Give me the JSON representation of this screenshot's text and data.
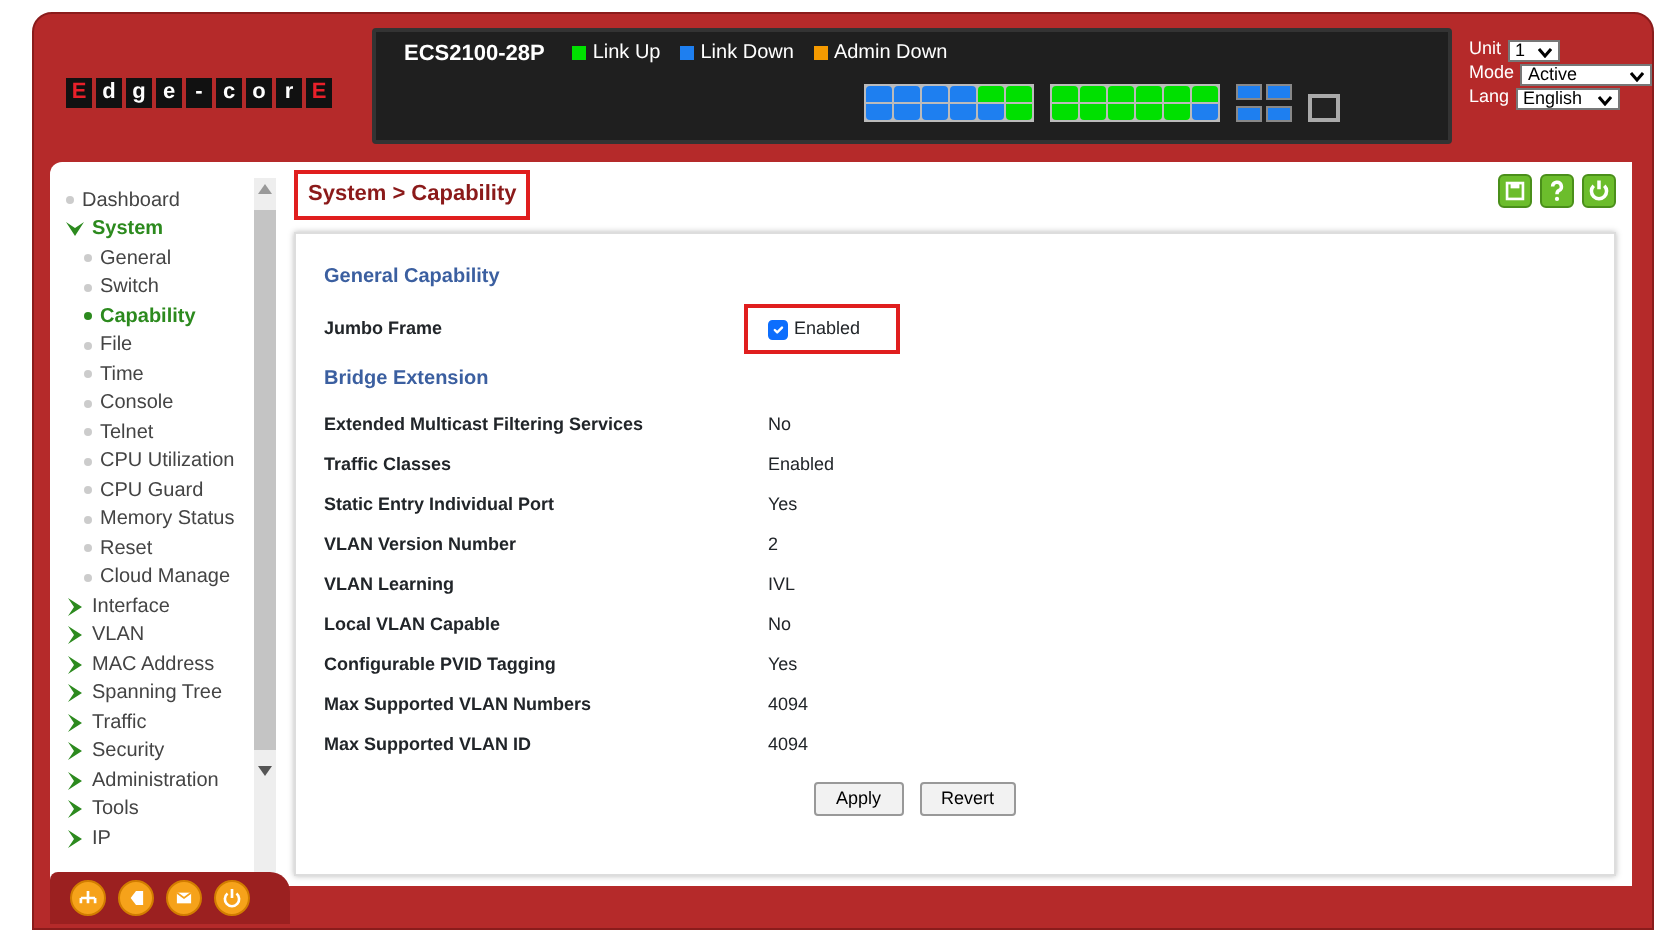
{
  "header": {
    "logo_tiles": [
      {
        "letter": "E",
        "red": true
      },
      {
        "letter": "d",
        "red": false
      },
      {
        "letter": "g",
        "red": false
      },
      {
        "letter": "e",
        "red": false
      },
      {
        "letter": "-",
        "red": false
      },
      {
        "letter": "c",
        "red": false
      },
      {
        "letter": "o",
        "red": false
      },
      {
        "letter": "r",
        "red": false
      },
      {
        "letter": "E",
        "red": true
      }
    ],
    "model": "ECS2100-28P",
    "legend": [
      {
        "label": "Link Up",
        "color": "#00e000"
      },
      {
        "label": "Link Down",
        "color": "#1e7ff0"
      },
      {
        "label": "Admin Down",
        "color": "#f59a00"
      }
    ],
    "port_blocks": [
      {
        "top": [
          {
            "link_up": false
          },
          {
            "link_up": false
          },
          {
            "link_up": false
          },
          {
            "link_up": false
          },
          {
            "link_up": true
          },
          {
            "link_up": true
          }
        ],
        "bottom": [
          {
            "link_up": false
          },
          {
            "link_up": false
          },
          {
            "link_up": false
          },
          {
            "link_up": false
          },
          {
            "link_up": false
          },
          {
            "link_up": true
          }
        ]
      },
      {
        "top": [
          {
            "link_up": true
          },
          {
            "link_up": true
          },
          {
            "link_up": true
          },
          {
            "link_up": true
          },
          {
            "link_up": true
          },
          {
            "link_up": true
          }
        ],
        "bottom": [
          {
            "link_up": true
          },
          {
            "link_up": true
          },
          {
            "link_up": true
          },
          {
            "link_up": true
          },
          {
            "link_up": true
          },
          {
            "link_up": false
          }
        ]
      }
    ],
    "sfp_ports": [
      {
        "link_up": false
      },
      {
        "link_up": false
      },
      {
        "link_up": false
      },
      {
        "link_up": false
      }
    ],
    "selectors": [
      {
        "label": "Unit",
        "value": "1"
      },
      {
        "label": "Mode",
        "value": "Active"
      },
      {
        "label": "Lang",
        "value": "English"
      }
    ]
  },
  "sidebar": {
    "items": [
      {
        "label": "Dashboard",
        "kind": "leaf",
        "selected": false
      },
      {
        "label": "System",
        "kind": "folder",
        "expanded": true,
        "children": [
          {
            "label": "General",
            "kind": "leaf",
            "selected": false
          },
          {
            "label": "Switch",
            "kind": "leaf",
            "selected": false
          },
          {
            "label": "Capability",
            "kind": "leaf",
            "selected": true
          },
          {
            "label": "File",
            "kind": "leaf",
            "selected": false
          },
          {
            "label": "Time",
            "kind": "leaf",
            "selected": false
          },
          {
            "label": "Console",
            "kind": "leaf",
            "selected": false
          },
          {
            "label": "Telnet",
            "kind": "leaf",
            "selected": false
          },
          {
            "label": "CPU Utilization",
            "kind": "leaf",
            "selected": false
          },
          {
            "label": "CPU Guard",
            "kind": "leaf",
            "selected": false
          },
          {
            "label": "Memory Status",
            "kind": "leaf",
            "selected": false
          },
          {
            "label": "Reset",
            "kind": "leaf",
            "selected": false
          },
          {
            "label": "Cloud Manage",
            "kind": "leaf",
            "selected": false
          }
        ]
      },
      {
        "label": "Interface",
        "kind": "folder",
        "expanded": false
      },
      {
        "label": "VLAN",
        "kind": "folder",
        "expanded": false
      },
      {
        "label": "MAC Address",
        "kind": "folder",
        "expanded": false
      },
      {
        "label": "Spanning Tree",
        "kind": "folder",
        "expanded": false
      },
      {
        "label": "Traffic",
        "kind": "folder",
        "expanded": false
      },
      {
        "label": "Security",
        "kind": "folder",
        "expanded": false
      },
      {
        "label": "Administration",
        "kind": "folder",
        "expanded": false
      },
      {
        "label": "Tools",
        "kind": "folder",
        "expanded": false
      },
      {
        "label": "IP",
        "kind": "folder",
        "expanded": false
      }
    ]
  },
  "breadcrumb": "System > Capability",
  "sections": [
    {
      "title": "General Capability",
      "rows": [
        {
          "label": "Jumbo Frame",
          "kind": "checkbox",
          "checked": true,
          "value": "Enabled"
        }
      ]
    },
    {
      "title": "Bridge Extension",
      "rows": [
        {
          "label": "Extended Multicast Filtering Services",
          "kind": "text",
          "value": "No"
        },
        {
          "label": "Traffic Classes",
          "kind": "text",
          "value": "Enabled"
        },
        {
          "label": "Static Entry Individual Port",
          "kind": "text",
          "value": "Yes"
        },
        {
          "label": "VLAN Version Number",
          "kind": "text",
          "value": "2"
        },
        {
          "label": "VLAN Learning",
          "kind": "text",
          "value": "IVL"
        },
        {
          "label": "Local VLAN Capable",
          "kind": "text",
          "value": "No"
        },
        {
          "label": "Configurable PVID Tagging",
          "kind": "text",
          "value": "Yes"
        },
        {
          "label": "Max Supported VLAN Numbers",
          "kind": "text",
          "value": "4094"
        },
        {
          "label": "Max Supported VLAN ID",
          "kind": "text",
          "value": "4094"
        }
      ]
    }
  ],
  "buttons": [
    "Apply",
    "Revert"
  ]
}
